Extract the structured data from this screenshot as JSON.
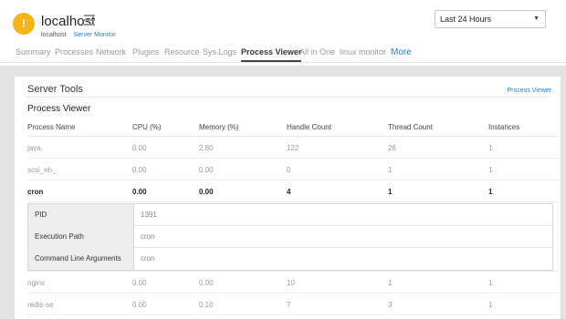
{
  "header": {
    "host_title": "localhost",
    "host_sub": "localhost",
    "monitor_link": "Server Monitor",
    "period": "Last 24 Hours"
  },
  "tabs": [
    {
      "label": "Summary"
    },
    {
      "label": "Processes"
    },
    {
      "label": "Network"
    },
    {
      "label": "Plugins"
    },
    {
      "label": "Resource"
    },
    {
      "label": "Sys Logs"
    },
    {
      "label": "Process Viewer"
    },
    {
      "label": "All in One"
    },
    {
      "label": "linux monitor"
    },
    {
      "label": "More"
    }
  ],
  "panel": {
    "title": "Server Tools",
    "link": "Process Viewer",
    "section_title": "Process Viewer"
  },
  "table": {
    "headers": [
      "Process Name",
      "CPU (%)",
      "Memory (%)",
      "Handle Count",
      "Thread Count",
      "Instances"
    ],
    "rows": [
      [
        "java",
        "0.00",
        "2.80",
        "122",
        "26",
        "1"
      ],
      [
        "scsi_eh_",
        "0.00",
        "0.00",
        "0",
        "1",
        "1"
      ],
      [
        "cron",
        "0.00",
        "0.00",
        "4",
        "1",
        "1"
      ],
      [
        "nginx",
        "0.00",
        "0.00",
        "10",
        "1",
        "1"
      ],
      [
        "redis-se",
        "0.00",
        "0.10",
        "7",
        "3",
        "1"
      ]
    ],
    "details": [
      {
        "key": "PID",
        "value": "1391"
      },
      {
        "key": "Execution Path",
        "value": "cron"
      },
      {
        "key": "Command Line Arguments",
        "value": "cron"
      }
    ]
  },
  "colors": {
    "accent": "#2b7bd0",
    "alert": "#f3b51a",
    "background": "#e3e3e3"
  },
  "icons": {
    "alert": "warning-icon",
    "menu": "hamburger-menu-icon",
    "dropdown": "chevron-down-icon"
  }
}
